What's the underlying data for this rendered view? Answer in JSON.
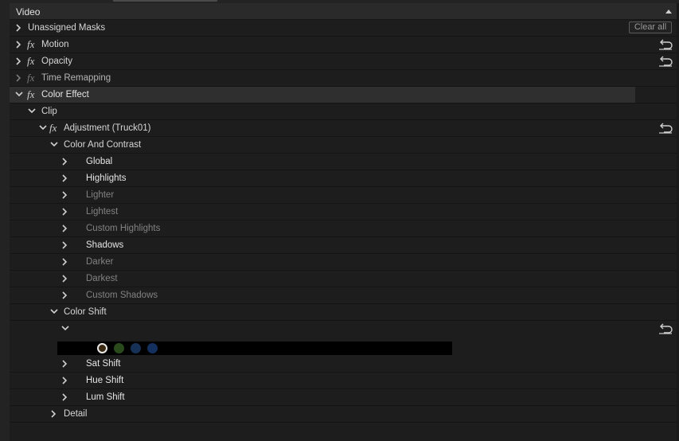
{
  "panel": {
    "section_title": "Video",
    "clear_all_label": "Clear all"
  },
  "rows": {
    "unassigned_masks": "Unassigned Masks",
    "motion": "Motion",
    "opacity": "Opacity",
    "time_remapping": "Time Remapping",
    "color_effect": "Color Effect",
    "clip": "Clip",
    "adjustment": "Adjustment (Truck01)",
    "color_and_contrast": "Color And Contrast",
    "global": "Global",
    "highlights": "Highlights",
    "lighter": "Lighter",
    "lightest": "Lightest",
    "custom_highlights": "Custom Highlights",
    "shadows": "Shadows",
    "darker": "Darker",
    "darkest": "Darkest",
    "custom_shadows": "Custom Shadows",
    "color_shift": "Color Shift",
    "sat_shift": "Sat Shift",
    "hue_shift": "Hue Shift",
    "lum_shift": "Lum Shift",
    "detail": "Detail"
  },
  "fx_glyph": "fx",
  "swatches": [
    {
      "color": "#3a2a14",
      "selected": true
    },
    {
      "color": "#2a4a1c",
      "selected": false
    },
    {
      "color": "#173056",
      "selected": false
    },
    {
      "color": "#14305e",
      "selected": false
    }
  ],
  "icons": {
    "expand": "chevron-right-icon",
    "collapse": "chevron-down-icon",
    "reset": "reset-icon",
    "panel_collapse": "triangle-up-icon"
  }
}
